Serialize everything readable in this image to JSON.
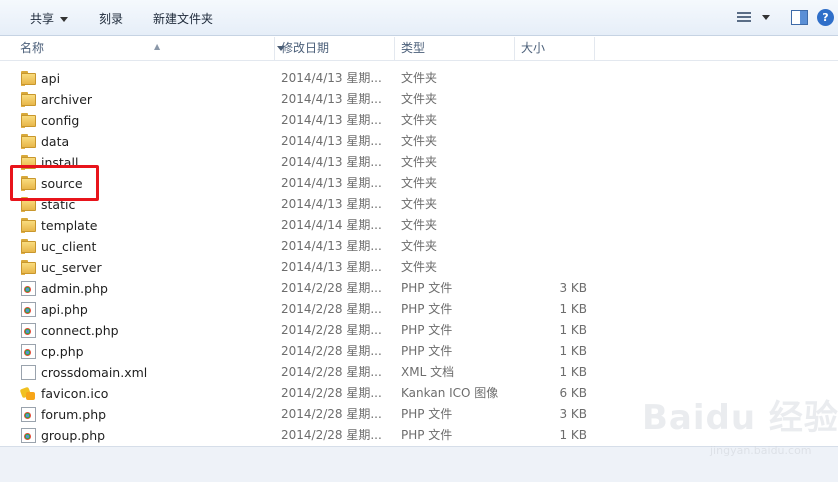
{
  "toolbar": {
    "share_label": "共享",
    "burn_label": "刻录",
    "new_folder_label": "新建文件夹",
    "view_icon": "details-view-icon",
    "preview_pane_icon": "preview-pane-icon",
    "help_icon": "help-icon",
    "help_glyph": "?"
  },
  "columns": {
    "name": "名称",
    "modified": "修改日期",
    "type": "类型",
    "size": "大小"
  },
  "files": [
    {
      "name": "api",
      "date": "2014/4/13 星期...",
      "type": "文件夹",
      "size": "",
      "icon": "folder"
    },
    {
      "name": "archiver",
      "date": "2014/4/13 星期...",
      "type": "文件夹",
      "size": "",
      "icon": "folder"
    },
    {
      "name": "config",
      "date": "2014/4/13 星期...",
      "type": "文件夹",
      "size": "",
      "icon": "folder"
    },
    {
      "name": "data",
      "date": "2014/4/13 星期...",
      "type": "文件夹",
      "size": "",
      "icon": "folder"
    },
    {
      "name": "install",
      "date": "2014/4/13 星期...",
      "type": "文件夹",
      "size": "",
      "icon": "folder"
    },
    {
      "name": "source",
      "date": "2014/4/13 星期...",
      "type": "文件夹",
      "size": "",
      "icon": "folder"
    },
    {
      "name": "static",
      "date": "2014/4/13 星期...",
      "type": "文件夹",
      "size": "",
      "icon": "folder"
    },
    {
      "name": "template",
      "date": "2014/4/14 星期...",
      "type": "文件夹",
      "size": "",
      "icon": "folder"
    },
    {
      "name": "uc_client",
      "date": "2014/4/13 星期...",
      "type": "文件夹",
      "size": "",
      "icon": "folder"
    },
    {
      "name": "uc_server",
      "date": "2014/4/13 星期...",
      "type": "文件夹",
      "size": "",
      "icon": "folder"
    },
    {
      "name": "admin.php",
      "date": "2014/2/28 星期...",
      "type": "PHP 文件",
      "size": "3 KB",
      "icon": "php"
    },
    {
      "name": "api.php",
      "date": "2014/2/28 星期...",
      "type": "PHP 文件",
      "size": "1 KB",
      "icon": "php"
    },
    {
      "name": "connect.php",
      "date": "2014/2/28 星期...",
      "type": "PHP 文件",
      "size": "1 KB",
      "icon": "php"
    },
    {
      "name": "cp.php",
      "date": "2014/2/28 星期...",
      "type": "PHP 文件",
      "size": "1 KB",
      "icon": "php"
    },
    {
      "name": "crossdomain.xml",
      "date": "2014/2/28 星期...",
      "type": "XML 文档",
      "size": "1 KB",
      "icon": "doc"
    },
    {
      "name": "favicon.ico",
      "date": "2014/2/28 星期...",
      "type": "Kankan ICO 图像",
      "size": "6 KB",
      "icon": "ico"
    },
    {
      "name": "forum.php",
      "date": "2014/2/28 星期...",
      "type": "PHP 文件",
      "size": "3 KB",
      "icon": "php"
    },
    {
      "name": "group.php",
      "date": "2014/2/28 星期...",
      "type": "PHP 文件",
      "size": "1 KB",
      "icon": "php"
    }
  ],
  "highlight": {
    "target": "source",
    "color": "#e8141b"
  },
  "watermark": {
    "text": "Baidu 经验",
    "sub": "jingyan.baidu.com"
  }
}
